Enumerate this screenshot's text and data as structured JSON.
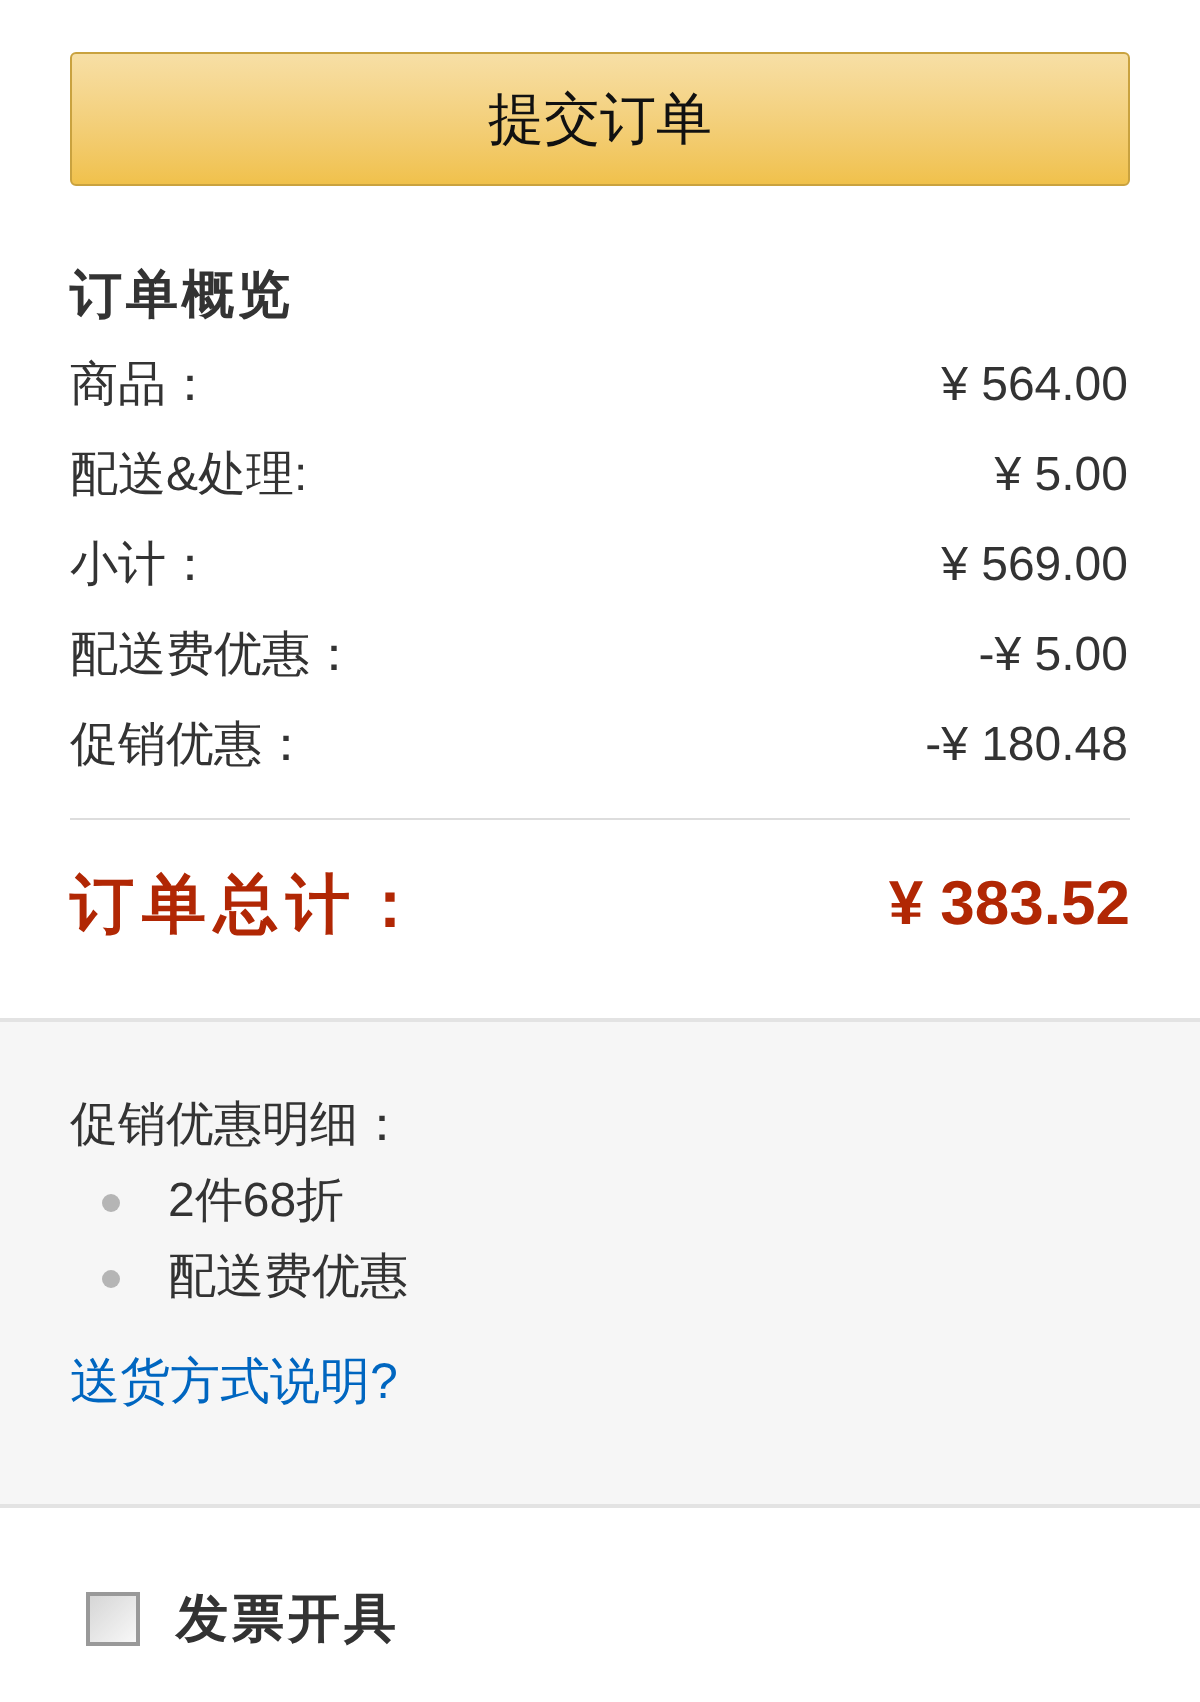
{
  "submit_button": {
    "label": "提交订单"
  },
  "order_summary": {
    "title": "订单概览",
    "rows": [
      {
        "label": "商品：",
        "value": "¥ 564.00"
      },
      {
        "label": "配送&处理:",
        "value": "¥ 5.00"
      },
      {
        "label": "小计：",
        "value": "¥ 569.00"
      },
      {
        "label": "配送费优惠：",
        "value": "-¥ 5.00"
      },
      {
        "label": "促销优惠：",
        "value": "-¥ 180.48"
      }
    ],
    "total": {
      "label": "订单总计：",
      "value": "¥ 383.52"
    }
  },
  "promotion_details": {
    "title": "促销优惠明细：",
    "items": [
      "2件68折",
      "配送费优惠"
    ],
    "link": "送货方式说明?"
  },
  "invoice": {
    "label": "发票开具",
    "checked": false
  }
}
